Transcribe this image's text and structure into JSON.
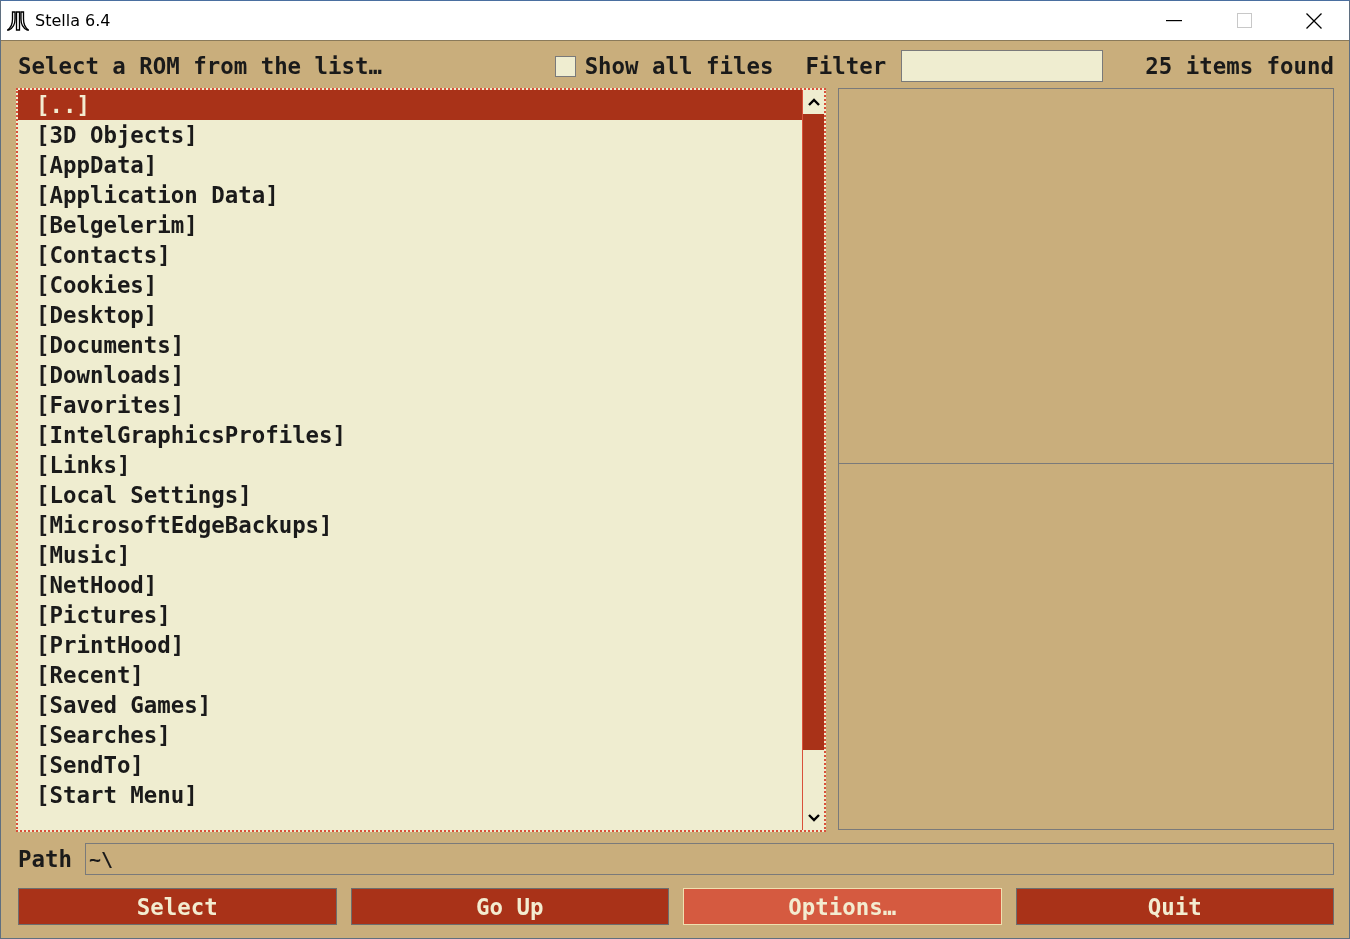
{
  "window": {
    "title": "Stella 6.4",
    "maximize_disabled": true
  },
  "header": {
    "heading": "Select a ROM from the list…",
    "show_all_files": {
      "label": "Show all files",
      "checked": false
    },
    "filter": {
      "label": "Filter"
    },
    "count": "25 items found"
  },
  "file_list": {
    "items": [
      {
        "label": "[..]",
        "selected": true
      },
      {
        "label": "[3D Objects]",
        "selected": false
      },
      {
        "label": "[AppData]",
        "selected": false
      },
      {
        "label": "[Application Data]",
        "selected": false
      },
      {
        "label": "[Belgelerim]",
        "selected": false
      },
      {
        "label": "[Contacts]",
        "selected": false
      },
      {
        "label": "[Cookies]",
        "selected": false
      },
      {
        "label": "[Desktop]",
        "selected": false
      },
      {
        "label": "[Documents]",
        "selected": false
      },
      {
        "label": "[Downloads]",
        "selected": false
      },
      {
        "label": "[Favorites]",
        "selected": false
      },
      {
        "label": "[IntelGraphicsProfiles]",
        "selected": false
      },
      {
        "label": "[Links]",
        "selected": false
      },
      {
        "label": "[Local Settings]",
        "selected": false
      },
      {
        "label": "[MicrosoftEdgeBackups]",
        "selected": false
      },
      {
        "label": "[Music]",
        "selected": false
      },
      {
        "label": "[NetHood]",
        "selected": false
      },
      {
        "label": "[Pictures]",
        "selected": false
      },
      {
        "label": "[PrintHood]",
        "selected": false
      },
      {
        "label": "[Recent]",
        "selected": false
      },
      {
        "label": "[Saved Games]",
        "selected": false
      },
      {
        "label": "[Searches]",
        "selected": false
      },
      {
        "label": "[SendTo]",
        "selected": false
      },
      {
        "label": "[Start Menu]",
        "selected": false
      }
    ]
  },
  "path": {
    "label": "Path",
    "value": "~\\"
  },
  "buttons": [
    {
      "label": "Select",
      "focused": false
    },
    {
      "label": "Go Up",
      "focused": false
    },
    {
      "label": "Options…",
      "focused": true
    },
    {
      "label": "Quit",
      "focused": false
    }
  ]
}
